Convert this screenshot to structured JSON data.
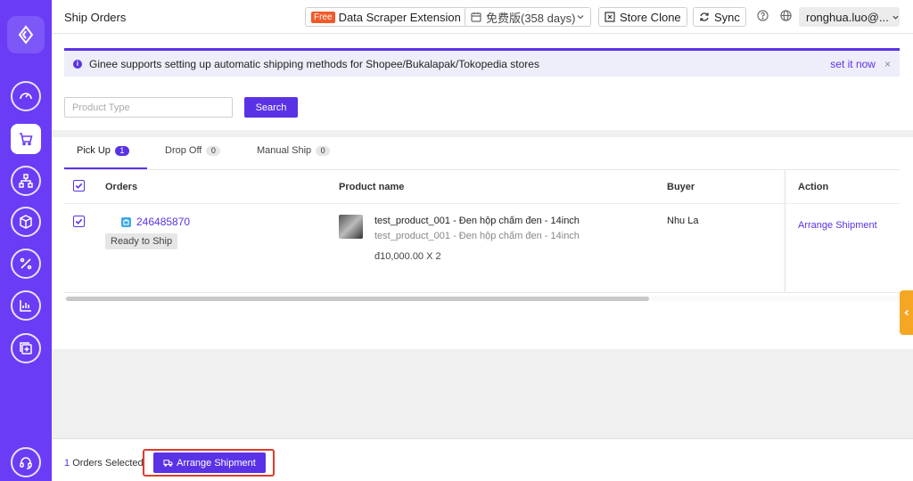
{
  "header": {
    "title": "Ship Orders",
    "free_badge": "Free",
    "scraper_label": "Data Scraper Extension",
    "plan_label": "免费版(358 days)",
    "store_clone_label": "Store Clone",
    "sync_label": "Sync",
    "user_label": "ronghua.luo@..."
  },
  "notice": {
    "text": "Ginee supports setting up automatic shipping methods for Shopee/Bukalapak/Tokopedia stores",
    "link": "set it now",
    "close": "×"
  },
  "search": {
    "placeholder": "Product Type",
    "button_label": "Search"
  },
  "tabs": [
    {
      "label": "Pick Up",
      "count": "1"
    },
    {
      "label": "Drop Off",
      "count": "0"
    },
    {
      "label": "Manual Ship",
      "count": "0"
    }
  ],
  "table": {
    "headers": [
      "Orders",
      "Product name",
      "Buyer",
      "Action"
    ],
    "rows": [
      {
        "order_id": "246485870",
        "status": "Ready to Ship",
        "product_name": "test_product_001 - Đen hộp chấm đen - 14inch",
        "product_variant": "test_product_001 - Đen hộp chấm đen - 14inch",
        "price": "đ10,000.00 X 2",
        "buyer": "Nhu La",
        "action": "Arrange Shipment"
      }
    ]
  },
  "footer": {
    "selected_count": "1",
    "selected_label": "Orders Selected",
    "button_label": "Arrange Shipment"
  },
  "colors": {
    "brand": "#6a3cf5",
    "primary": "#5a32e6",
    "highlight": "#e03b2c",
    "handle": "#f5a623"
  },
  "icons": {
    "sidebar": [
      "dashboard-icon",
      "cart-icon",
      "sitemap-icon",
      "box-icon",
      "percent-icon",
      "chart-icon",
      "add-square-icon",
      "headset-icon"
    ]
  }
}
